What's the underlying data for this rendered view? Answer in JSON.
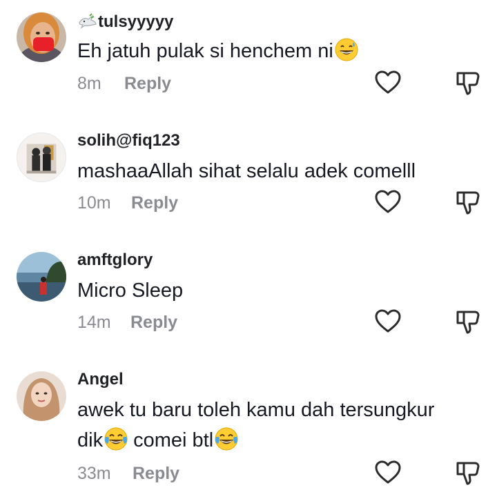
{
  "comments": [
    {
      "username": "tulsyyyyy",
      "username_prefix_icon": "dove-icon",
      "text": "Eh jatuh pulak si henchem ni",
      "text_emoji": "grinning-sweat-emoji",
      "time": "8m",
      "reply_label": "Reply",
      "avatar_icon": "avatar-red-mask"
    },
    {
      "username": "solih@fiq123",
      "text": "mashaaAllah sihat selalu adek comelll",
      "time": "10m",
      "reply_label": "Reply",
      "avatar_icon": "avatar-two-people"
    },
    {
      "username": "amftglory",
      "text": "Micro Sleep",
      "time": "14m",
      "reply_label": "Reply",
      "avatar_icon": "avatar-beach"
    },
    {
      "username": "Angel",
      "text_line1": "awek tu baru toleh kamu dah tersungkur",
      "text_line2_a": "dik",
      "text_line2_b": " comei btl",
      "text_emoji": "tears-of-joy-emoji",
      "time": "33m",
      "reply_label": "Reply",
      "avatar_icon": "avatar-hijab"
    }
  ],
  "colors": {
    "username": "#1f2125",
    "text": "#161823",
    "meta": "#8a8b91",
    "icon_stroke": "#2b2b2b"
  }
}
